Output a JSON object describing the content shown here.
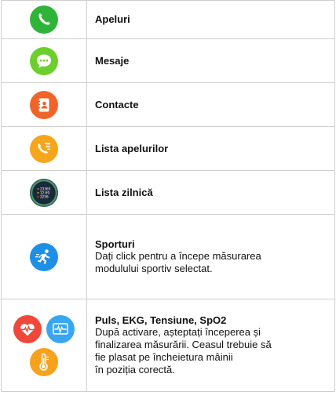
{
  "rows": [
    {
      "label": "Apeluri",
      "icon": "phone-icon"
    },
    {
      "label": "Mesaje",
      "icon": "message-icon"
    },
    {
      "label": "Contacte",
      "icon": "contacts-icon"
    },
    {
      "label": "Lista apelurilor",
      "icon": "call-list-icon"
    },
    {
      "label": "Lista zilnică",
      "icon": "daily-list-icon",
      "screen_lines": [
        "23365",
        "12.69",
        "2256"
      ]
    },
    {
      "label": "Sporturi",
      "icon": "sport-runner-icon",
      "description": "Dați click pentru a începe măsurarea modulului sportiv selectat."
    },
    {
      "label": "Puls, EKG, Tensiune, SpO2",
      "icons": [
        "heart-rate-icon",
        "ekg-icon",
        "thermometer-icon"
      ],
      "description_lines": [
        "După activare, așteptați începerea și",
        "finalizarea măsurării. Ceasul trebuie să",
        "fie plasat pe încheietura mâinii",
        "în poziția corectă."
      ]
    }
  ],
  "colors": {
    "phone": "#2fb43a",
    "message": "#6dcf2e",
    "contacts": "#f0642a",
    "call_list": "#f6a61c",
    "daily_list": "#1b2a3a",
    "sport": "#1e8fe6",
    "heart": "#f0473a",
    "ekg": "#3aa6ef",
    "thermometer": "#f7a21c",
    "border": "#cfcfcf"
  }
}
